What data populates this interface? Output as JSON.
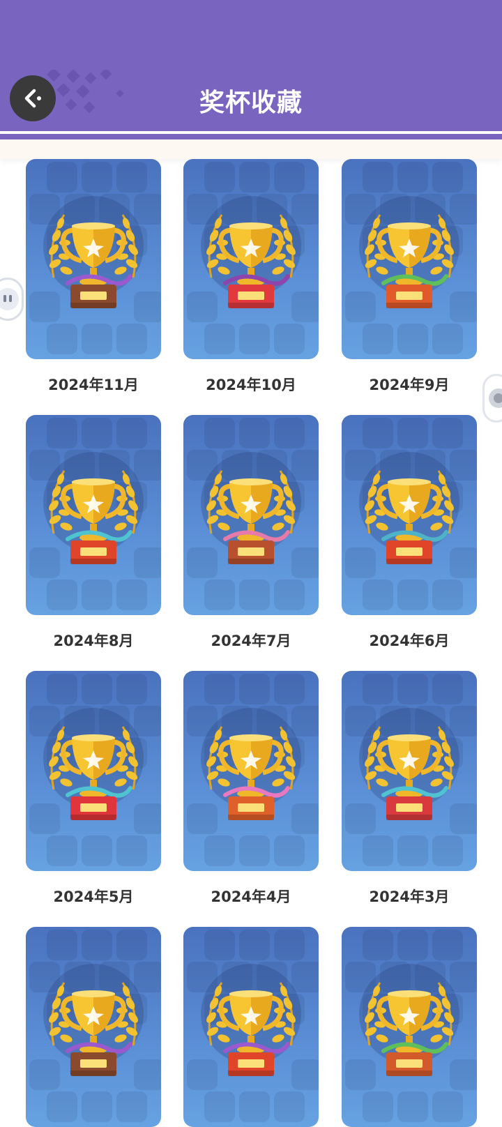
{
  "header": {
    "title": "奖杯收藏",
    "back_icon": "back-arrow-icon",
    "bg_color": "#7964c0"
  },
  "trophies": [
    {
      "label": "2024年11月",
      "base_color": "#8b4a2e",
      "ribbon": "#9b59d0"
    },
    {
      "label": "2024年10月",
      "base_color": "#e03a3e",
      "ribbon": "#8e44ad"
    },
    {
      "label": "2024年9月",
      "base_color": "#e05a2a",
      "ribbon": "#5fbf5a"
    },
    {
      "label": "2024年8月",
      "base_color": "#e0452a",
      "ribbon": "#4fc3d0"
    },
    {
      "label": "2024年7月",
      "base_color": "#b8502e",
      "ribbon": "#e67aa8"
    },
    {
      "label": "2024年6月",
      "base_color": "#e0452a",
      "ribbon": "#4fb3c8"
    },
    {
      "label": "2024年5月",
      "base_color": "#e0353a",
      "ribbon": "#4fc3d0"
    },
    {
      "label": "2024年4月",
      "base_color": "#e0602a",
      "ribbon": "#e879c0"
    },
    {
      "label": "2024年3月",
      "base_color": "#d93a3e",
      "ribbon": "#4fc3d0"
    },
    {
      "label": "",
      "base_color": "#8b4a2e",
      "ribbon": "#9b59d0"
    },
    {
      "label": "",
      "base_color": "#e0452a",
      "ribbon": "#9b59d0"
    },
    {
      "label": "",
      "base_color": "#d35a2a",
      "ribbon": "#5fbf5a"
    }
  ],
  "side_widgets": {
    "left_icon": "pause-float-icon",
    "right_icon": "float-assistant-icon"
  }
}
